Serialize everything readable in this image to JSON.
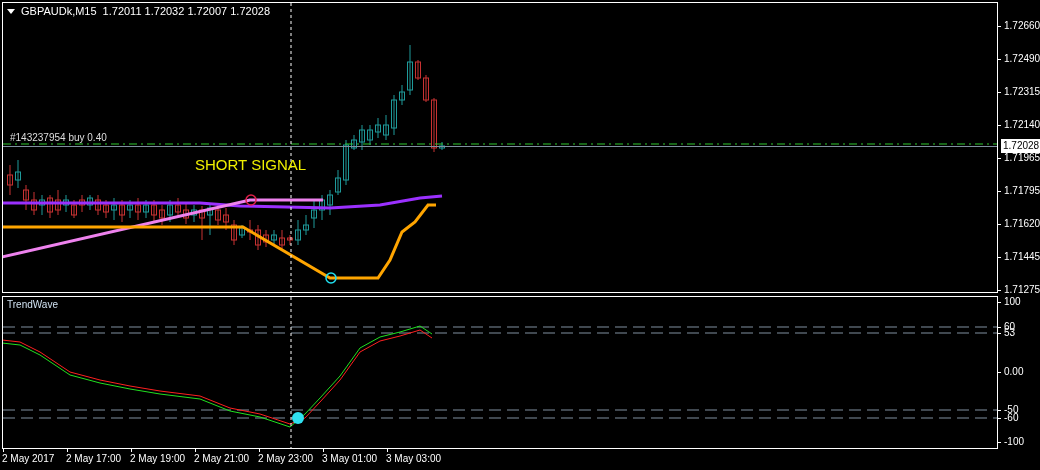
{
  "main_chart": {
    "symbol": "GBPAUDk,M15",
    "quotes": "1.72011 1.72032 1.72007 1.72028",
    "order_label": "#143237954 buy 0.40",
    "signal_text": "SHORT SIGNAL",
    "price_ticks": [
      "1.72660",
      "1.72490",
      "1.72315",
      "1.72140",
      "1.71965",
      "1.71795",
      "1.71620",
      "1.71445",
      "1.71275"
    ],
    "current_price": "1.72028"
  },
  "indicator": {
    "name": "TrendWave",
    "level_ticks": [
      "100",
      "60",
      "53",
      "0.00",
      "-50",
      "-60",
      "-100"
    ]
  },
  "time_axis": [
    "2 May 2017",
    "2 May 17:00",
    "2 May 19:00",
    "2 May 21:00",
    "2 May 23:00",
    "3 May 01:00",
    "3 May 03:00"
  ]
}
